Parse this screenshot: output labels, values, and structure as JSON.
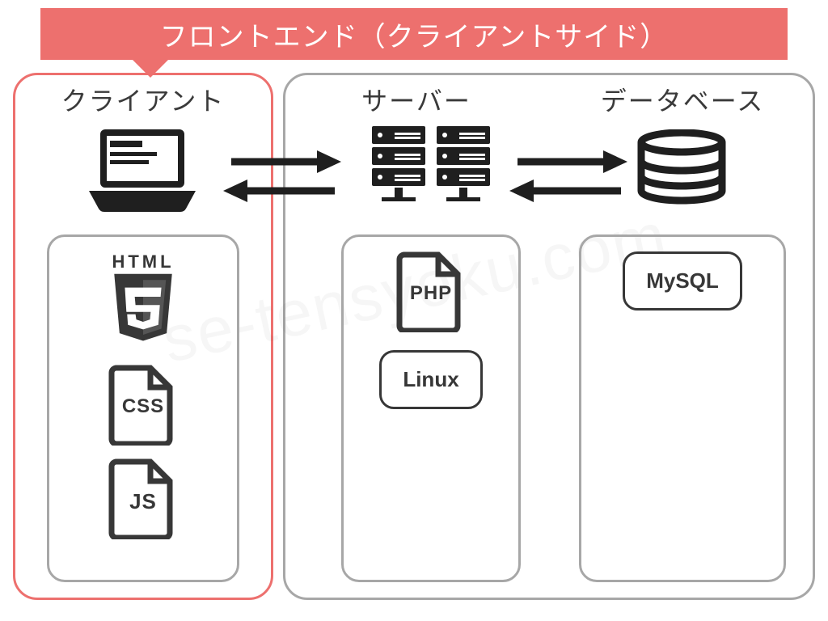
{
  "banner": {
    "title": "フロントエンド（クライアントサイド）"
  },
  "columns": {
    "client": {
      "title": "クライアント"
    },
    "server": {
      "title": "サーバー"
    },
    "database": {
      "title": "データベース"
    }
  },
  "tech": {
    "client": {
      "html_label": "HTML",
      "css_label": "CSS",
      "js_label": "JS"
    },
    "server": {
      "php_label": "PHP",
      "linux_label": "Linux"
    },
    "database": {
      "mysql_label": "MySQL"
    }
  },
  "watermark": "se-tensyoku.com",
  "colors": {
    "accent": "#ed706e",
    "line": "#a7a7a7",
    "ink": "#1f1f1f"
  }
}
